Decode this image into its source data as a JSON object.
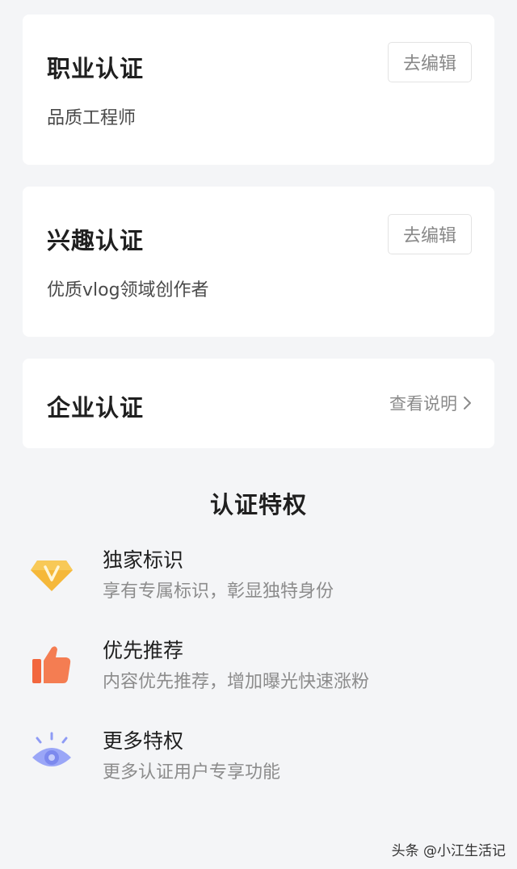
{
  "cards": [
    {
      "title": "职业认证",
      "desc": "品质工程师",
      "button": "去编辑"
    },
    {
      "title": "兴趣认证",
      "desc": "优质vlog领域创作者",
      "button": "去编辑"
    },
    {
      "title": "企业认证",
      "link": "查看说明"
    }
  ],
  "privileges": {
    "title": "认证特权",
    "items": [
      {
        "title": "独家标识",
        "desc": "享有专属标识，彰显独特身份",
        "icon": "diamond-v-icon"
      },
      {
        "title": "优先推荐",
        "desc": "内容优先推荐，增加曝光快速涨粉",
        "icon": "thumbs-up-icon"
      },
      {
        "title": "更多特权",
        "desc": "更多认证用户专享功能",
        "icon": "eye-icon"
      }
    ]
  },
  "watermark": "头条 @小江生活记",
  "colors": {
    "background": "#f4f5f7",
    "diamond": "#f5b83a",
    "thumb": "#f2673e",
    "eye": "#8e9bf5"
  }
}
